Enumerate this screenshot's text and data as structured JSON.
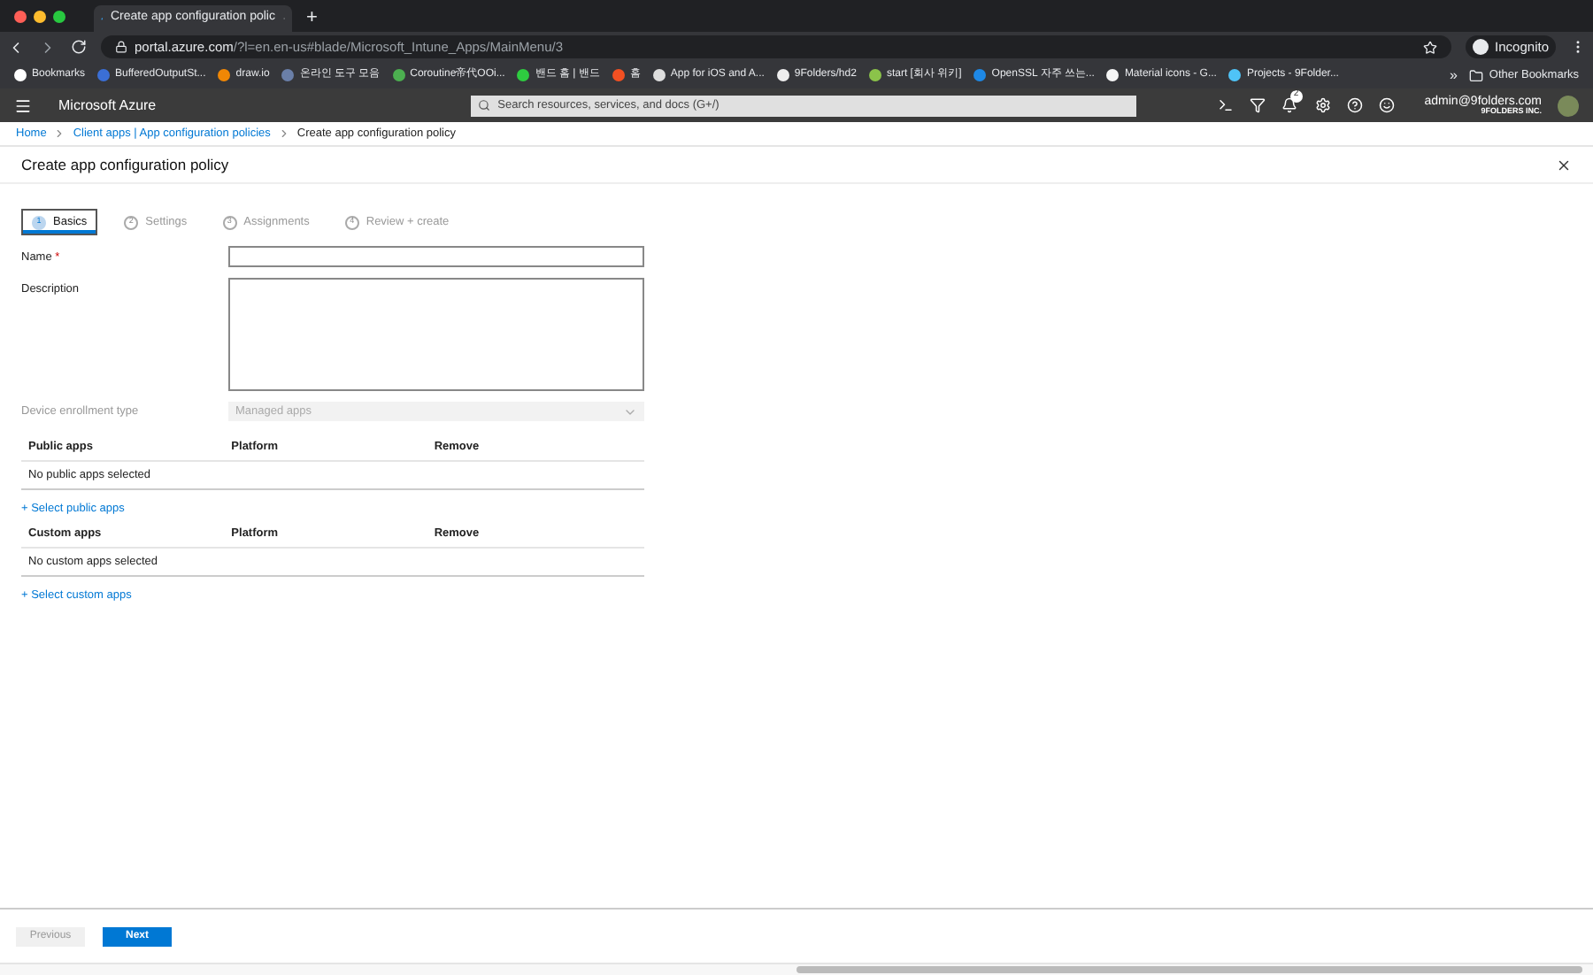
{
  "browser": {
    "tab_title": "Create app configuration polic",
    "new_tab": "+",
    "url_host": "portal.azure.com",
    "url_path": "/?l=en.en-us#blade/Microsoft_Intune_Apps/MainMenu/3",
    "profile": "Incognito"
  },
  "bookmarks": [
    {
      "label": "Bookmarks",
      "color": "#ffffff"
    },
    {
      "label": "BufferedOutputSt...",
      "color": "#3b6fd6"
    },
    {
      "label": "draw.io",
      "color": "#f08705"
    },
    {
      "label": "온라인 도구 모음",
      "color": "#6a7fa8"
    },
    {
      "label": "Coroutine帝代OOi...",
      "color": "#4caf50"
    },
    {
      "label": "밴드 홈 | 밴드",
      "color": "#2ecc40"
    },
    {
      "label": "홈",
      "color": "#f25022"
    },
    {
      "label": "App for iOS and A...",
      "color": "#dddddd"
    },
    {
      "label": "9Folders/hd2",
      "color": "#eeeeee"
    },
    {
      "label": "start [회사 위키]",
      "color": "#8bc34a"
    },
    {
      "label": "OpenSSL 자주 쓰는...",
      "color": "#1e88e5"
    },
    {
      "label": "Material icons - G...",
      "color": "#f5f5f5"
    },
    {
      "label": "Projects - 9Folder...",
      "color": "#4fc3f7"
    }
  ],
  "bookmarks_more": "»",
  "other_bookmarks": "Other Bookmarks",
  "portal": {
    "brand": "Microsoft Azure",
    "search_placeholder": "Search resources, services, and docs (G+/)",
    "notification_count": "2",
    "user": "admin@9folders.com",
    "org": "9FOLDERS INC."
  },
  "breadcrumb": [
    {
      "label": "Home",
      "link": true
    },
    {
      "label": "Client apps | App configuration policies",
      "link": true
    },
    {
      "label": "Create app configuration policy",
      "link": false
    }
  ],
  "title": "Create app configuration policy",
  "steps": [
    {
      "number": "1",
      "label": "Basics",
      "selected": true
    },
    {
      "number": "2",
      "label": "Settings",
      "selected": false
    },
    {
      "number": "3",
      "label": "Assignments",
      "selected": false
    },
    {
      "number": "4",
      "label": "Review + create",
      "selected": false
    }
  ],
  "form": {
    "name_label": "Name",
    "required_mark": "*",
    "description_label": "Description",
    "enrollment_label": "Device enrollment type",
    "enrollment_value": "Managed apps",
    "enrollment_disabled": true
  },
  "tables": [
    {
      "columns": [
        "Public apps",
        "Platform",
        "Remove"
      ],
      "empty": "No public apps selected",
      "add_link": "+ Select public apps"
    },
    {
      "columns": [
        "Custom apps",
        "Platform",
        "Remove"
      ],
      "empty": "No custom apps selected",
      "add_link": "+ Select custom apps"
    }
  ],
  "footer": {
    "previous": {
      "label": "Previous",
      "disabled": true
    },
    "next": {
      "label": "Next",
      "disabled": false
    }
  }
}
